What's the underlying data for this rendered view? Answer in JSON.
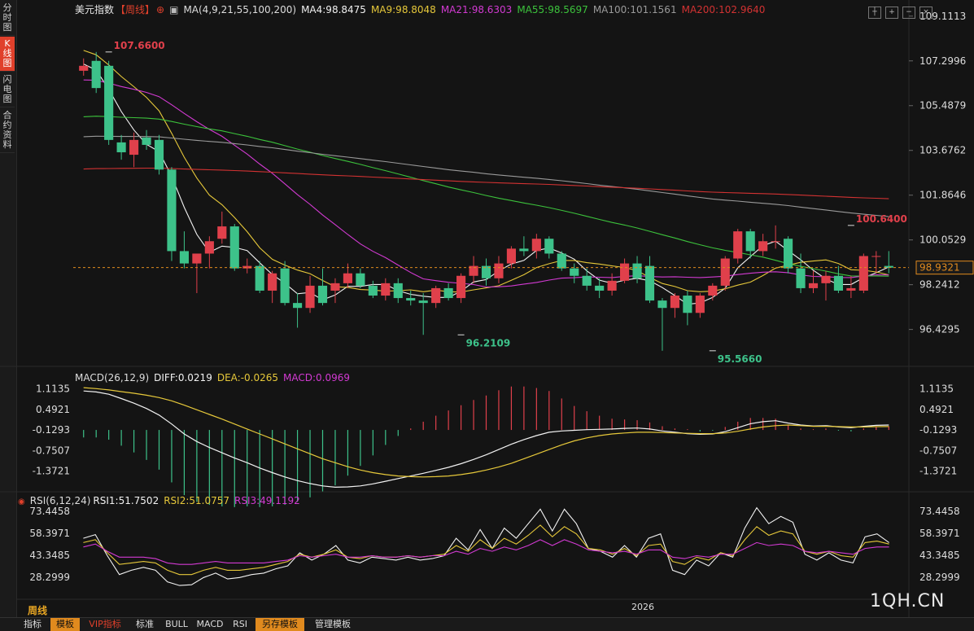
{
  "left_tabs": [
    "分时图",
    "K线图",
    "闪电图",
    "合约资料"
  ],
  "legend_main": {
    "title": "美元指数",
    "period": "【周线】",
    "ma_params": "MA(4,9,21,55,100,200)",
    "ma4": "MA4:98.8475",
    "ma9": "MA9:98.8048",
    "ma21": "MA21:98.6303",
    "ma55": "MA55:98.5697",
    "ma100": "MA100:101.1561",
    "ma200": "MA200:102.9640"
  },
  "legend_macd": {
    "params": "MACD(26,12,9)",
    "diff": "DIFF:0.0219",
    "dea": "DEA:-0.0265",
    "macd": "MACD:0.0969"
  },
  "legend_rsi": {
    "params": "RSI(6,12,24)",
    "rsi1": "RSI1:51.7502",
    "rsi2": "RSI2:51.0757",
    "rsi3": "RSI3:49.1192"
  },
  "colors": {
    "up": "#e0404b",
    "down": "#3dc28a",
    "ma4": "#f2f2f2",
    "ma9": "#e6c83a",
    "ma21": "#d23ad2",
    "ma55": "#3cc23c",
    "ma100": "#9a9a9a",
    "ma200": "#d23232",
    "price_line": "#e08a1e"
  },
  "bottom_tabs": [
    "指标",
    "模板",
    "VIP指标",
    "标准",
    "BULL",
    "MACD",
    "RSI",
    "另存模板",
    "管理模板"
  ],
  "period_label": "周线",
  "year_label": "2026",
  "watermark": "1QH.CN",
  "chart_data": [
    {
      "type": "candlestick",
      "title": "美元指数",
      "yticks": [
        "109.1113",
        "107.2996",
        "105.4879",
        "103.6762",
        "101.8646",
        "100.0529",
        "98.2412",
        "96.4295"
      ],
      "ylim": [
        95.0,
        109.5
      ],
      "current_price": "98.9321",
      "current_value": 98.9321,
      "annotations": [
        {
          "label": "107.6600",
          "index": 1,
          "value": 107.66
        },
        {
          "label": "96.2109",
          "index": 19,
          "value": 96.2109
        },
        {
          "label": "95.5660",
          "index": 31,
          "value": 95.566
        },
        {
          "label": "100.6400",
          "index": 38,
          "value": 100.64
        }
      ],
      "candles": [
        [
          106.9,
          107.4,
          106.7,
          107.1
        ],
        [
          107.3,
          107.66,
          106.0,
          106.2
        ],
        [
          107.1,
          107.3,
          103.9,
          104.1
        ],
        [
          104.0,
          104.3,
          103.3,
          103.6
        ],
        [
          103.5,
          104.4,
          103.0,
          104.1
        ],
        [
          104.2,
          104.5,
          103.7,
          103.9
        ],
        [
          104.1,
          104.3,
          102.7,
          102.9
        ],
        [
          102.9,
          103.0,
          99.2,
          99.6
        ],
        [
          99.6,
          100.4,
          98.9,
          99.1
        ],
        [
          99.1,
          99.4,
          97.9,
          99.5
        ],
        [
          99.5,
          100.2,
          98.9,
          100.0
        ],
        [
          100.1,
          101.2,
          99.9,
          100.6
        ],
        [
          100.6,
          100.7,
          98.8,
          98.9
        ],
        [
          98.9,
          99.3,
          98.7,
          99.0
        ],
        [
          99.0,
          99.2,
          97.9,
          98.0
        ],
        [
          98.0,
          98.8,
          97.5,
          98.7
        ],
        [
          98.9,
          99.2,
          97.4,
          97.5
        ],
        [
          97.5,
          97.9,
          96.5,
          97.3
        ],
        [
          97.3,
          98.6,
          97.1,
          98.2
        ],
        [
          98.2,
          98.9,
          97.4,
          97.5
        ],
        [
          98.0,
          98.5,
          97.5,
          98.3
        ],
        [
          98.3,
          99.1,
          98.1,
          98.7
        ],
        [
          98.7,
          98.9,
          98.1,
          98.2
        ],
        [
          98.2,
          98.4,
          97.7,
          97.8
        ],
        [
          97.8,
          98.5,
          97.6,
          98.3
        ],
        [
          98.3,
          98.5,
          97.5,
          97.7
        ],
        [
          97.7,
          98.0,
          97.4,
          97.6
        ],
        [
          97.6,
          97.9,
          96.2109,
          97.5
        ],
        [
          97.5,
          98.2,
          97.3,
          98.1
        ],
        [
          98.1,
          98.3,
          97.6,
          97.7
        ],
        [
          97.7,
          98.7,
          97.5,
          98.6
        ],
        [
          98.6,
          99.4,
          98.3,
          99.0
        ],
        [
          99.0,
          99.3,
          98.2,
          98.5
        ],
        [
          98.5,
          99.4,
          98.3,
          99.1
        ],
        [
          99.1,
          99.8,
          98.9,
          99.7
        ],
        [
          99.7,
          100.2,
          99.4,
          99.6
        ],
        [
          99.6,
          100.3,
          99.3,
          100.1
        ],
        [
          100.1,
          100.2,
          99.3,
          99.5
        ],
        [
          99.5,
          99.6,
          98.8,
          98.9
        ],
        [
          98.9,
          99.1,
          98.3,
          98.6
        ],
        [
          98.6,
          98.9,
          98.0,
          98.2
        ],
        [
          98.2,
          98.5,
          97.7,
          98.0
        ],
        [
          98.0,
          98.7,
          97.8,
          98.4
        ],
        [
          98.4,
          99.3,
          98.3,
          99.1
        ],
        [
          99.1,
          99.4,
          98.3,
          98.5
        ],
        [
          99.0,
          99.4,
          97.5,
          97.6
        ],
        [
          97.6,
          97.7,
          95.566,
          97.3
        ],
        [
          97.3,
          97.9,
          96.9,
          97.8
        ],
        [
          97.8,
          98.0,
          96.6,
          97.1
        ],
        [
          97.1,
          97.9,
          96.9,
          97.8
        ],
        [
          97.8,
          98.3,
          97.6,
          98.2
        ],
        [
          98.2,
          99.4,
          98.0,
          99.3
        ],
        [
          99.3,
          100.5,
          99.1,
          100.4
        ],
        [
          100.4,
          100.5,
          99.3,
          99.6
        ],
        [
          99.6,
          100.3,
          99.4,
          100.0
        ],
        [
          100.0,
          100.64,
          99.7,
          100.0
        ],
        [
          100.1,
          100.2,
          98.7,
          98.9
        ],
        [
          98.9,
          99.5,
          97.9,
          98.1
        ],
        [
          98.1,
          98.8,
          97.9,
          98.3
        ],
        [
          98.3,
          98.8,
          97.6,
          98.6
        ],
        [
          98.6,
          99.0,
          97.9,
          98.0
        ],
        [
          98.0,
          98.6,
          97.7,
          98.1
        ],
        [
          98.0,
          99.5,
          97.9,
          99.4
        ],
        [
          99.4,
          99.6,
          98.7,
          99.4
        ],
        [
          99.0,
          99.6,
          98.7,
          98.93
        ]
      ]
    },
    {
      "type": "bar+line",
      "title": "MACD",
      "yticks": [
        "1.1135",
        "0.4921",
        "-0.1293",
        "-0.7507",
        "-1.3721"
      ],
      "ylim": [
        -1.9,
        1.3
      ],
      "series": [
        {
          "name": "DIFF",
          "values": [
            1.05,
            1.02,
            0.95,
            0.82,
            0.68,
            0.52,
            0.32,
            0.05,
            -0.25,
            -0.48,
            -0.66,
            -0.82,
            -0.98,
            -1.12,
            -1.28,
            -1.42,
            -1.55,
            -1.66,
            -1.75,
            -1.82,
            -1.86,
            -1.85,
            -1.82,
            -1.76,
            -1.68,
            -1.6,
            -1.52,
            -1.44,
            -1.35,
            -1.26,
            -1.15,
            -1.02,
            -0.88,
            -0.72,
            -0.56,
            -0.42,
            -0.3,
            -0.2,
            -0.16,
            -0.14,
            -0.12,
            -0.11,
            -0.1,
            -0.08,
            -0.07,
            -0.1,
            -0.16,
            -0.2,
            -0.24,
            -0.26,
            -0.25,
            -0.18,
            -0.06,
            0.06,
            0.12,
            0.15,
            0.08,
            0.02,
            -0.01,
            0.0,
            -0.04,
            -0.06,
            -0.02,
            0.01,
            0.02
          ]
        },
        {
          "name": "DEA",
          "values": [
            1.15,
            1.12,
            1.08,
            1.03,
            0.98,
            0.92,
            0.85,
            0.75,
            0.62,
            0.48,
            0.34,
            0.2,
            0.05,
            -0.1,
            -0.25,
            -0.4,
            -0.55,
            -0.7,
            -0.85,
            -1.0,
            -1.12,
            -1.24,
            -1.34,
            -1.42,
            -1.48,
            -1.52,
            -1.54,
            -1.55,
            -1.54,
            -1.52,
            -1.48,
            -1.42,
            -1.34,
            -1.25,
            -1.14,
            -1.0,
            -0.86,
            -0.72,
            -0.58,
            -0.46,
            -0.37,
            -0.3,
            -0.25,
            -0.22,
            -0.2,
            -0.2,
            -0.21,
            -0.22,
            -0.23,
            -0.24,
            -0.24,
            -0.22,
            -0.17,
            -0.1,
            -0.04,
            0.0,
            0.02,
            0.0,
            -0.02,
            -0.02,
            -0.03,
            -0.04,
            -0.04,
            -0.03,
            -0.0265
          ]
        },
        {
          "name": "MACD",
          "values": [
            -0.2,
            -0.2,
            -0.26,
            -0.42,
            -0.6,
            -0.8,
            -1.06,
            -1.4,
            -1.74,
            -1.92,
            -2.0,
            -2.04,
            -2.06,
            -2.04,
            -2.06,
            -2.04,
            -2.0,
            -1.92,
            -1.8,
            -1.64,
            -1.48,
            -1.22,
            -0.96,
            -0.68,
            -0.4,
            -0.16,
            0.04,
            0.22,
            0.38,
            0.52,
            0.66,
            0.8,
            0.92,
            1.06,
            1.16,
            1.16,
            1.12,
            1.04,
            0.84,
            0.64,
            0.5,
            0.38,
            0.3,
            0.28,
            0.26,
            0.2,
            0.1,
            0.04,
            0.02,
            -0.04,
            -0.02,
            0.08,
            0.22,
            0.32,
            0.32,
            0.3,
            0.12,
            0.04,
            0.02,
            0.04,
            -0.02,
            -0.04,
            0.04,
            0.08,
            0.0969
          ]
        }
      ]
    },
    {
      "type": "line",
      "title": "RSI",
      "yticks": [
        "73.4458",
        "58.3971",
        "43.3485",
        "28.2999"
      ],
      "ylim": [
        22.0,
        78.0
      ],
      "series": [
        {
          "name": "RSI1",
          "values": [
            55.0,
            57.5,
            43.0,
            30.0,
            33.0,
            35.0,
            33.0,
            25.0,
            22.5,
            23.0,
            28.0,
            31.0,
            27.0,
            28.0,
            30.0,
            31.0,
            34.0,
            36.0,
            45.0,
            40.0,
            44.0,
            50.0,
            40.0,
            38.0,
            42.0,
            41.0,
            40.0,
            42.0,
            40.0,
            41.0,
            43.0,
            55.0,
            47.0,
            61.0,
            48.0,
            62.0,
            55.0,
            65.0,
            75.0,
            60.0,
            75.0,
            65.0,
            48.0,
            46.0,
            42.0,
            50.0,
            42.0,
            55.0,
            58.0,
            33.0,
            30.0,
            40.0,
            36.0,
            45.0,
            42.0,
            62.0,
            76.0,
            65.0,
            70.0,
            66.0,
            44.0,
            40.0,
            45.0,
            40.0,
            38.0,
            56.0,
            58.0,
            52.0
          ]
        },
        {
          "name": "RSI2",
          "values": [
            52.0,
            54.0,
            45.0,
            37.0,
            38.0,
            39.0,
            38.0,
            33.0,
            30.0,
            30.0,
            33.0,
            35.0,
            33.0,
            33.0,
            34.0,
            35.0,
            37.0,
            39.0,
            44.0,
            42.0,
            44.0,
            47.0,
            42.0,
            41.0,
            43.0,
            42.0,
            42.0,
            43.0,
            42.0,
            43.0,
            44.0,
            50.0,
            46.0,
            54.0,
            48.0,
            55.0,
            51.0,
            57.0,
            64.0,
            56.0,
            63.0,
            58.0,
            48.0,
            47.0,
            44.0,
            48.0,
            43.0,
            50.0,
            51.0,
            39.0,
            37.0,
            42.0,
            40.0,
            45.0,
            43.0,
            54.0,
            63.0,
            57.0,
            60.0,
            58.0,
            46.0,
            44.0,
            46.0,
            43.0,
            42.0,
            52.0,
            53.0,
            51.0
          ]
        },
        {
          "name": "RSI3",
          "values": [
            49.0,
            51.0,
            46.0,
            42.0,
            42.0,
            42.0,
            41.0,
            38.0,
            37.0,
            37.0,
            38.0,
            39.0,
            38.0,
            38.0,
            38.0,
            38.0,
            39.0,
            40.0,
            43.0,
            42.0,
            43.0,
            44.0,
            42.0,
            42.0,
            43.0,
            42.0,
            42.0,
            43.0,
            42.0,
            43.0,
            43.0,
            46.0,
            44.0,
            48.0,
            46.0,
            49.0,
            47.0,
            50.0,
            54.0,
            50.0,
            54.0,
            51.0,
            47.0,
            46.0,
            45.0,
            46.0,
            44.0,
            47.0,
            47.0,
            42.0,
            41.0,
            43.0,
            42.0,
            44.0,
            44.0,
            48.0,
            52.0,
            50.0,
            51.0,
            50.0,
            46.0,
            45.0,
            46.0,
            45.0,
            44.0,
            48.0,
            49.0,
            49.0
          ]
        }
      ]
    }
  ]
}
